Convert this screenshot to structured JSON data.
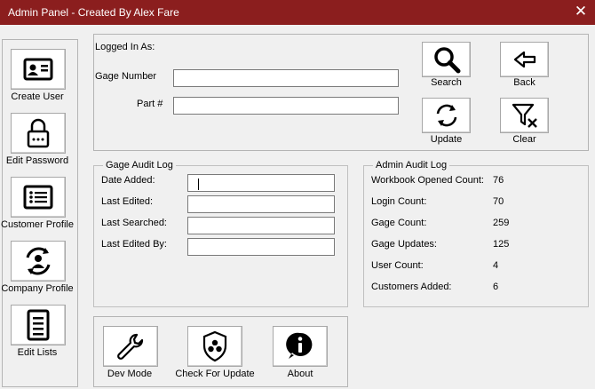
{
  "window": {
    "title": "Admin Panel  - Created By Alex Fare",
    "close_glyph": "✕"
  },
  "sidebar": {
    "items": [
      {
        "label": "Create User",
        "icon": "id-card-icon"
      },
      {
        "label": "Edit Password",
        "icon": "padlock-icon"
      },
      {
        "label": "Customer Profile",
        "icon": "list-icon"
      },
      {
        "label": "Company Profile",
        "icon": "user-sync-icon"
      },
      {
        "label": "Edit Lists",
        "icon": "document-list-icon"
      }
    ]
  },
  "search_panel": {
    "logged_in_label": "Logged In As:",
    "gage_number_label": "Gage Number",
    "gage_number_value": "",
    "part_label": "Part #",
    "part_value": "",
    "buttons": {
      "search": "Search",
      "back": "Back",
      "update": "Update",
      "clear": "Clear"
    }
  },
  "gage_audit": {
    "title": "Gage Audit Log",
    "fields": [
      {
        "label": "Date Added:",
        "value": ""
      },
      {
        "label": "Last Edited:",
        "value": ""
      },
      {
        "label": "Last Searched:",
        "value": ""
      },
      {
        "label": "Last Edited By:",
        "value": ""
      }
    ]
  },
  "admin_audit": {
    "title": "Admin Audit Log",
    "rows": [
      {
        "label": "Workbook Opened Count:",
        "value": "76"
      },
      {
        "label": "Login Count:",
        "value": "70"
      },
      {
        "label": "Gage Count:",
        "value": "259"
      },
      {
        "label": "Gage Updates:",
        "value": "125"
      },
      {
        "label": "User Count:",
        "value": "4"
      },
      {
        "label": "Customers Added:",
        "value": "6"
      }
    ]
  },
  "bottom_toolbar": {
    "dev_mode": "Dev Mode",
    "check_update": "Check For Update",
    "about": "About"
  },
  "colors": {
    "titlebar": "#8b1e1e",
    "background": "#f0f0f0"
  }
}
